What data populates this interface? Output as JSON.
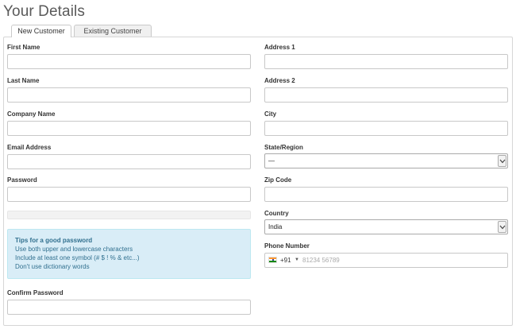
{
  "page": {
    "title": "Your Details"
  },
  "tabs": [
    {
      "label": "New Customer",
      "active": true
    },
    {
      "label": "Existing Customer",
      "active": false
    }
  ],
  "form": {
    "first_name": {
      "label": "First Name",
      "value": ""
    },
    "last_name": {
      "label": "Last Name",
      "value": ""
    },
    "company_name": {
      "label": "Company Name",
      "value": ""
    },
    "email": {
      "label": "Email Address",
      "value": ""
    },
    "password": {
      "label": "Password",
      "value": ""
    },
    "confirm_password": {
      "label": "Confirm Password",
      "value": ""
    },
    "address1": {
      "label": "Address 1",
      "value": ""
    },
    "address2": {
      "label": "Address 2",
      "value": ""
    },
    "city": {
      "label": "City",
      "value": ""
    },
    "state": {
      "label": "State/Region",
      "selected": "—"
    },
    "zip": {
      "label": "Zip Code",
      "value": ""
    },
    "country": {
      "label": "Country",
      "selected": "India"
    },
    "phone": {
      "label": "Phone Number",
      "dial_code": "+91",
      "placeholder": "81234 56789",
      "flag_icon": "india-flag-icon"
    }
  },
  "password_tips": {
    "title": "Tips for a good password",
    "items": [
      "Use both upper and lowercase characters",
      "Include at least one symbol (# $ ! % & etc...)",
      "Don't use dictionary words"
    ]
  },
  "colors": {
    "tips_background": "#d9edf7",
    "tips_text": "#31708f"
  }
}
